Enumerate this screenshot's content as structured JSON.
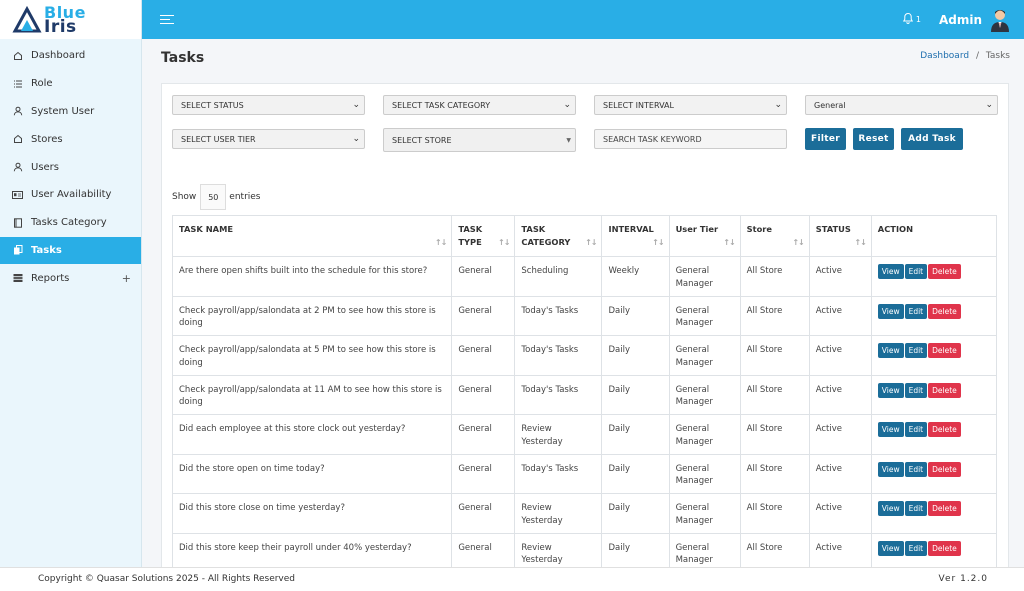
{
  "brand": {
    "line1": "Blue",
    "line2": "Iris"
  },
  "header": {
    "notification_count": "1",
    "admin_name": "Admin"
  },
  "sidebar": {
    "items": [
      {
        "label": "Dashboard",
        "icon": "home-icon"
      },
      {
        "label": "Role",
        "icon": "list-icon"
      },
      {
        "label": "System User",
        "icon": "user-icon"
      },
      {
        "label": "Stores",
        "icon": "home-icon"
      },
      {
        "label": "Users",
        "icon": "user-icon"
      },
      {
        "label": "User Availability",
        "icon": "id-card-icon"
      },
      {
        "label": "Tasks Category",
        "icon": "book-icon"
      },
      {
        "label": "Tasks",
        "icon": "copy-icon",
        "active": true
      },
      {
        "label": "Reports",
        "icon": "table-icon",
        "expand": "+"
      }
    ]
  },
  "page": {
    "title": "Tasks"
  },
  "breadcrumb": {
    "home": "Dashboard",
    "separator": "/",
    "current": "Tasks"
  },
  "filters": {
    "status": "SELECT STATUS",
    "category": "SELECT TASK CATEGORY",
    "interval": "SELECT INTERVAL",
    "type": "General",
    "user_tier": "SELECT USER TIER",
    "store": "SELECT STORE",
    "keyword_placeholder": "SEARCH TASK KEYWORD"
  },
  "buttons": {
    "filter": "Filter",
    "reset": "Reset",
    "add_task": "Add Task"
  },
  "entries": {
    "prefix": "Show",
    "value": "50",
    "suffix": "entries"
  },
  "table": {
    "columns": [
      {
        "label": "TASK NAME"
      },
      {
        "label": "TASK TYPE"
      },
      {
        "label": "TASK CATEGORY"
      },
      {
        "label": "INTERVAL"
      },
      {
        "label": "User Tier"
      },
      {
        "label": "Store"
      },
      {
        "label": "STATUS"
      },
      {
        "label": "ACTION"
      }
    ],
    "rows": [
      {
        "name": "Are there open shifts built into the schedule for this store?",
        "type": "General",
        "category": "Scheduling",
        "interval": "Weekly",
        "tier": "General Manager",
        "store": "All Store",
        "status": "Active"
      },
      {
        "name": "Check payroll/app/salondata at 2 PM to see how this store is doing",
        "type": "General",
        "category": "Today's Tasks",
        "interval": "Daily",
        "tier": "General Manager",
        "store": "All Store",
        "status": "Active"
      },
      {
        "name": "Check payroll/app/salondata at 5 PM to see how this store is doing",
        "type": "General",
        "category": "Today's Tasks",
        "interval": "Daily",
        "tier": "General Manager",
        "store": "All Store",
        "status": "Active"
      },
      {
        "name": "Check payroll/app/salondata at 11 AM to see how this store is doing",
        "type": "General",
        "category": "Today's Tasks",
        "interval": "Daily",
        "tier": "General Manager",
        "store": "All Store",
        "status": "Active"
      },
      {
        "name": "Did each employee at this store clock out yesterday?",
        "type": "General",
        "category": "Review Yesterday",
        "interval": "Daily",
        "tier": "General Manager",
        "store": "All Store",
        "status": "Active"
      },
      {
        "name": "Did the store open on time today?",
        "type": "General",
        "category": "Today's Tasks",
        "interval": "Daily",
        "tier": "General Manager",
        "store": "All Store",
        "status": "Active"
      },
      {
        "name": "Did this store close on time yesterday?",
        "type": "General",
        "category": "Review Yesterday",
        "interval": "Daily",
        "tier": "General Manager",
        "store": "All Store",
        "status": "Active"
      },
      {
        "name": "Did this store keep their payroll under 40% yesterday?",
        "type": "General",
        "category": "Review Yesterday",
        "interval": "Daily",
        "tier": "General Manager",
        "store": "All Store",
        "status": "Active"
      }
    ],
    "actions": {
      "view": "View",
      "edit": "Edit",
      "delete": "Delete"
    }
  },
  "footer": {
    "copyright": "Copyright © Quasar Solutions 2025 - All Rights Reserved",
    "version": "Ver 1.2.0"
  },
  "colors": {
    "primary": "#29aee6",
    "button": "#1b6d99",
    "danger": "#e0344b",
    "sidebar_bg": "#eaf6fc"
  }
}
